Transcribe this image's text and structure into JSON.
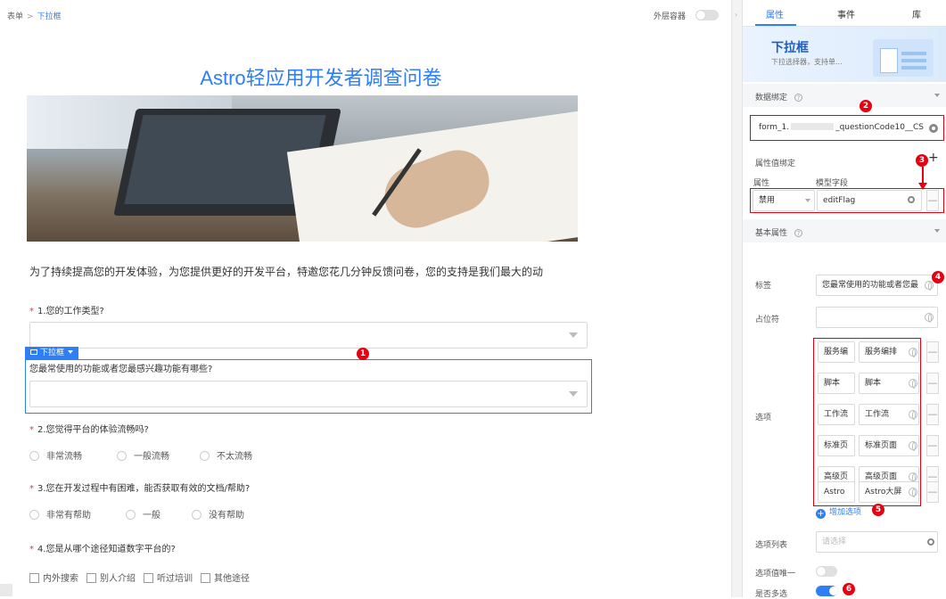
{
  "breadcrumb": {
    "root": "表单",
    "sep": ">",
    "current": "下拉框"
  },
  "toolbar": {
    "outer_container_label": "外层容器",
    "outer_container_on": false
  },
  "form": {
    "title": "Astro轻应用开发者调查问卷",
    "intro": "为了持续提高您的开发体验，为您提供更好的开发平台，特邀您花几分钟反馈问卷，您的支持是我们最大的动",
    "required_mark": "*",
    "q1": "1.您的工作类型?",
    "selected_tag": "下拉框",
    "selected_question": "您最常使用的功能或者您最感兴趣功能有哪些?",
    "q2": "2.您觉得平台的体验流畅吗?",
    "q2_options": [
      "非常流畅",
      "一般流畅",
      "不太流畅"
    ],
    "q3": "3.您在开发过程中有困难，能否获取有效的文档/帮助?",
    "q3_options": [
      "非常有帮助",
      "一般",
      "没有帮助"
    ],
    "q4": "4.您是从哪个途径知道数字平台的?",
    "q4_options": [
      "内外搜索",
      "别人介绍",
      "听过培训",
      "其他途径"
    ]
  },
  "panel": {
    "tabs": [
      "属性",
      "事件",
      "库"
    ],
    "active_tab": "属性",
    "component_title": "下拉框",
    "component_desc": "下拉选择器，支持单...",
    "data_binding_label": "数据绑定",
    "data_binding_prefix": "form_1.",
    "data_binding_suffix": "_questionCode10__CS",
    "prop_binding_label": "属性值绑定",
    "prop_col": "属性",
    "model_col": "模型字段",
    "prop_value": "禁用",
    "model_value": "editFlag",
    "basic_label": "基本属性",
    "label_label": "标签",
    "label_value": "您最常使用的功能或者您最",
    "placeholder_label": "占位符",
    "options_label": "选项",
    "options": [
      {
        "value": "服务编",
        "label": "服务编排"
      },
      {
        "value": "脚本",
        "label": "脚本"
      },
      {
        "value": "工作流",
        "label": "工作流"
      },
      {
        "value": "标准页",
        "label": "标准页面"
      },
      {
        "value": "高级页",
        "label": "高级页面"
      },
      {
        "value": "Astro",
        "label": "Astro大屏"
      }
    ],
    "add_option": "增加选项",
    "option_list_label": "选项列表",
    "option_list_placeholder": "请选择",
    "unique_label": "选项值唯一",
    "unique_on": false,
    "multi_label": "是否多选",
    "multi_on": true
  },
  "callouts": [
    "1",
    "2",
    "3",
    "4",
    "5",
    "6"
  ],
  "colors": {
    "accent": "#2e7ef5",
    "callout": "#e60012",
    "required": "#e4393c"
  }
}
